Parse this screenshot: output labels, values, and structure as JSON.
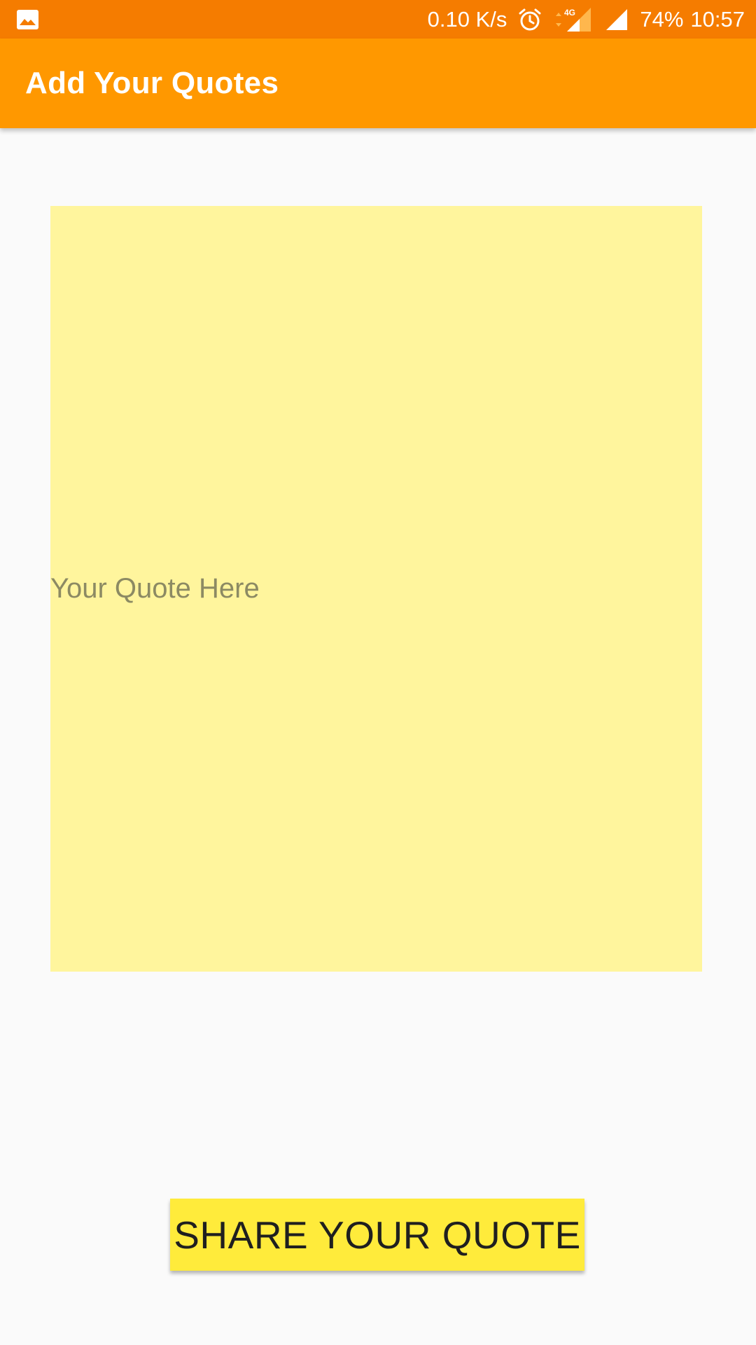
{
  "status_bar": {
    "network_speed": "0.10 K/s",
    "network_type": "4G",
    "battery": "74%",
    "time": "10:57",
    "icons": [
      "gallery-icon",
      "alarm-icon",
      "mobile-data-icon",
      "signal-icon"
    ]
  },
  "app_bar": {
    "title": "Add Your Quotes"
  },
  "quote": {
    "placeholder": "Your Quote Here",
    "value": ""
  },
  "actions": {
    "share_label": "SHARE YOUR QUOTE"
  },
  "colors": {
    "status_bar": "#f57c00",
    "app_bar": "#ff9800",
    "quote_background": "#fff59d",
    "button_background": "#ffeb3b",
    "page_background": "#fafafa"
  }
}
